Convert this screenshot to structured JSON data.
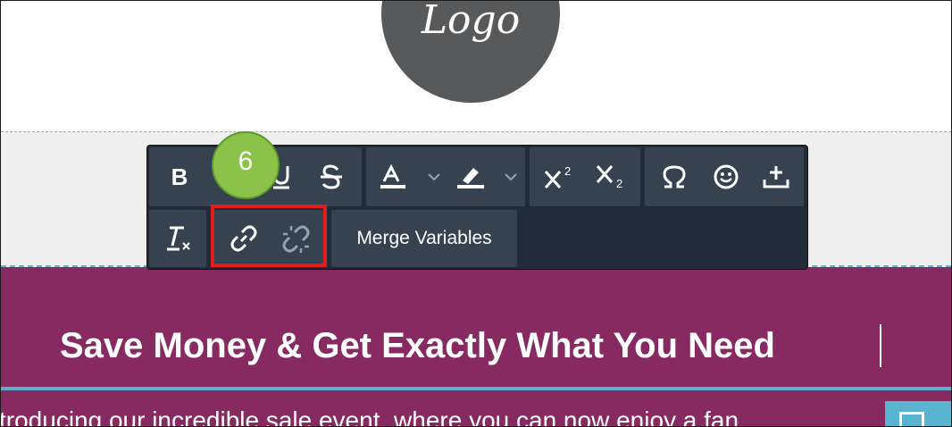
{
  "logo": {
    "text": "Logo"
  },
  "toolbar": {
    "bold_label": "B",
    "merge_variables_label": "Merge Variables",
    "icons": [
      "bold-icon",
      "italic-icon",
      "underline-icon",
      "strikethrough-icon",
      "text-color-icon",
      "highlight-icon",
      "superscript-icon",
      "subscript-icon",
      "omega-icon",
      "emoji-icon",
      "insert-icon",
      "clear-format-icon",
      "link-icon",
      "unlink-icon"
    ]
  },
  "annotation": {
    "step": "6"
  },
  "content": {
    "headline": "Save Money & Get Exactly What You Need",
    "intro": "troducing our incredible sale event, where you can now enjoy a fan"
  },
  "colors": {
    "banner": "#872a61",
    "toolbar": "#222c38",
    "toolbar_group": "#364250",
    "accent_blue": "#59b1cf",
    "highlight_red": "#e51c1c",
    "badge_green": "#8bc34a"
  }
}
